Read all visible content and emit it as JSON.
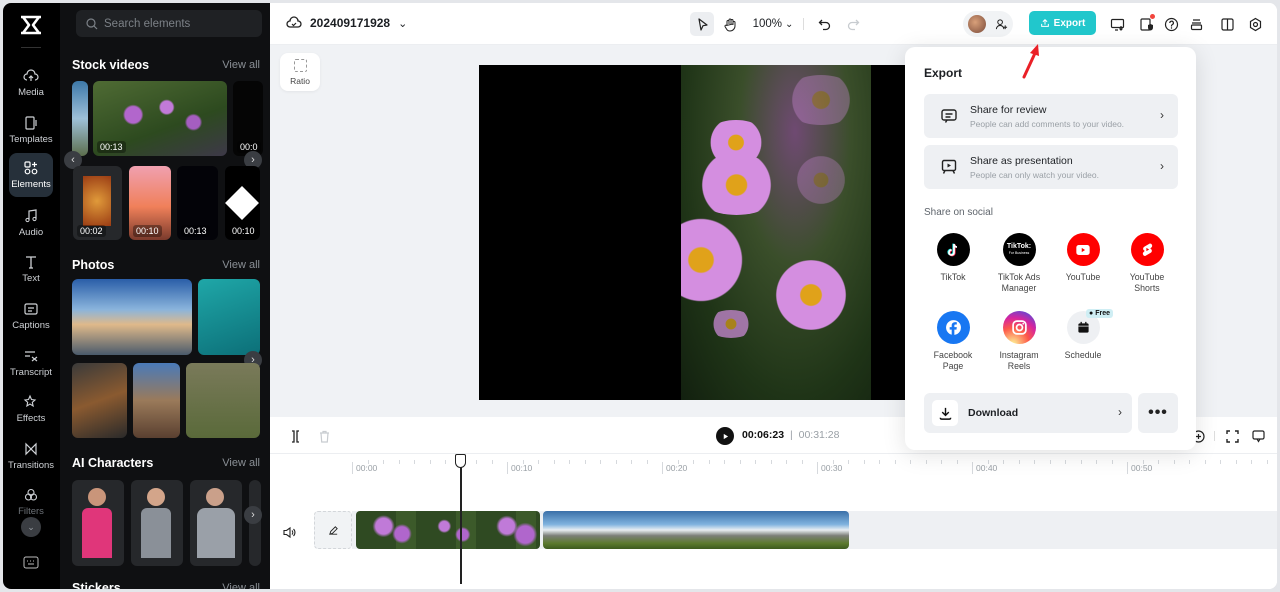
{
  "rail": {
    "items": [
      {
        "label": "Media",
        "icon": "cloud-upload-icon"
      },
      {
        "label": "Templates",
        "icon": "templates-icon"
      },
      {
        "label": "Elements",
        "icon": "elements-icon",
        "active": true
      },
      {
        "label": "Audio",
        "icon": "music-note-icon"
      },
      {
        "label": "Text",
        "icon": "text-icon"
      },
      {
        "label": "Captions",
        "icon": "captions-icon"
      },
      {
        "label": "Transcript",
        "icon": "transcript-icon"
      },
      {
        "label": "Effects",
        "icon": "effects-icon"
      },
      {
        "label": "Transitions",
        "icon": "transitions-icon"
      },
      {
        "label": "Filters",
        "icon": "filters-icon"
      }
    ]
  },
  "panel": {
    "search_placeholder": "Search elements",
    "sections": [
      {
        "title": "Stock videos",
        "view_all": "View all"
      },
      {
        "title": "Photos",
        "view_all": "View all"
      },
      {
        "title": "AI Characters",
        "view_all": "View all"
      },
      {
        "title": "Stickers",
        "view_all": "View all"
      }
    ],
    "stock_video_durations": [
      "00:13",
      "00:0",
      "00:02",
      "00:10",
      "00:13",
      "00:10"
    ]
  },
  "topbar": {
    "project_name": "202409171928",
    "zoom": "100%",
    "export_label": "Export"
  },
  "workspace": {
    "ratio_label": "Ratio"
  },
  "playback": {
    "current_time": "00:06:23",
    "separator": "|",
    "total_time": "00:31:28"
  },
  "timeline": {
    "ticks": [
      "00:00",
      "00:10",
      "00:20",
      "00:30",
      "00:40",
      "00:50"
    ]
  },
  "export_panel": {
    "title": "Export",
    "share_for_review": {
      "title": "Share for review",
      "subtitle": "People can add comments to your video."
    },
    "share_as_presentation": {
      "title": "Share as presentation",
      "subtitle": "People can only watch your video."
    },
    "social_label": "Share on social",
    "social": [
      {
        "label": "TikTok",
        "color": "#000000"
      },
      {
        "label": "TikTok Ads Manager",
        "color": "#000000"
      },
      {
        "label": "YouTube",
        "color": "#ff0000"
      },
      {
        "label": "YouTube Shorts",
        "color": "#ff0000"
      },
      {
        "label": "Facebook Page",
        "color": "#1877f2"
      },
      {
        "label": "Instagram Reels",
        "color": "#d62976"
      },
      {
        "label": "Schedule",
        "color": "#eef0f3"
      }
    ],
    "free_badge": "Free",
    "download_label": "Download",
    "more_label": "•••"
  },
  "colors": {
    "accent": "#21c7cc",
    "rail_bg": "#000000",
    "panel_bg": "#0f1012"
  }
}
